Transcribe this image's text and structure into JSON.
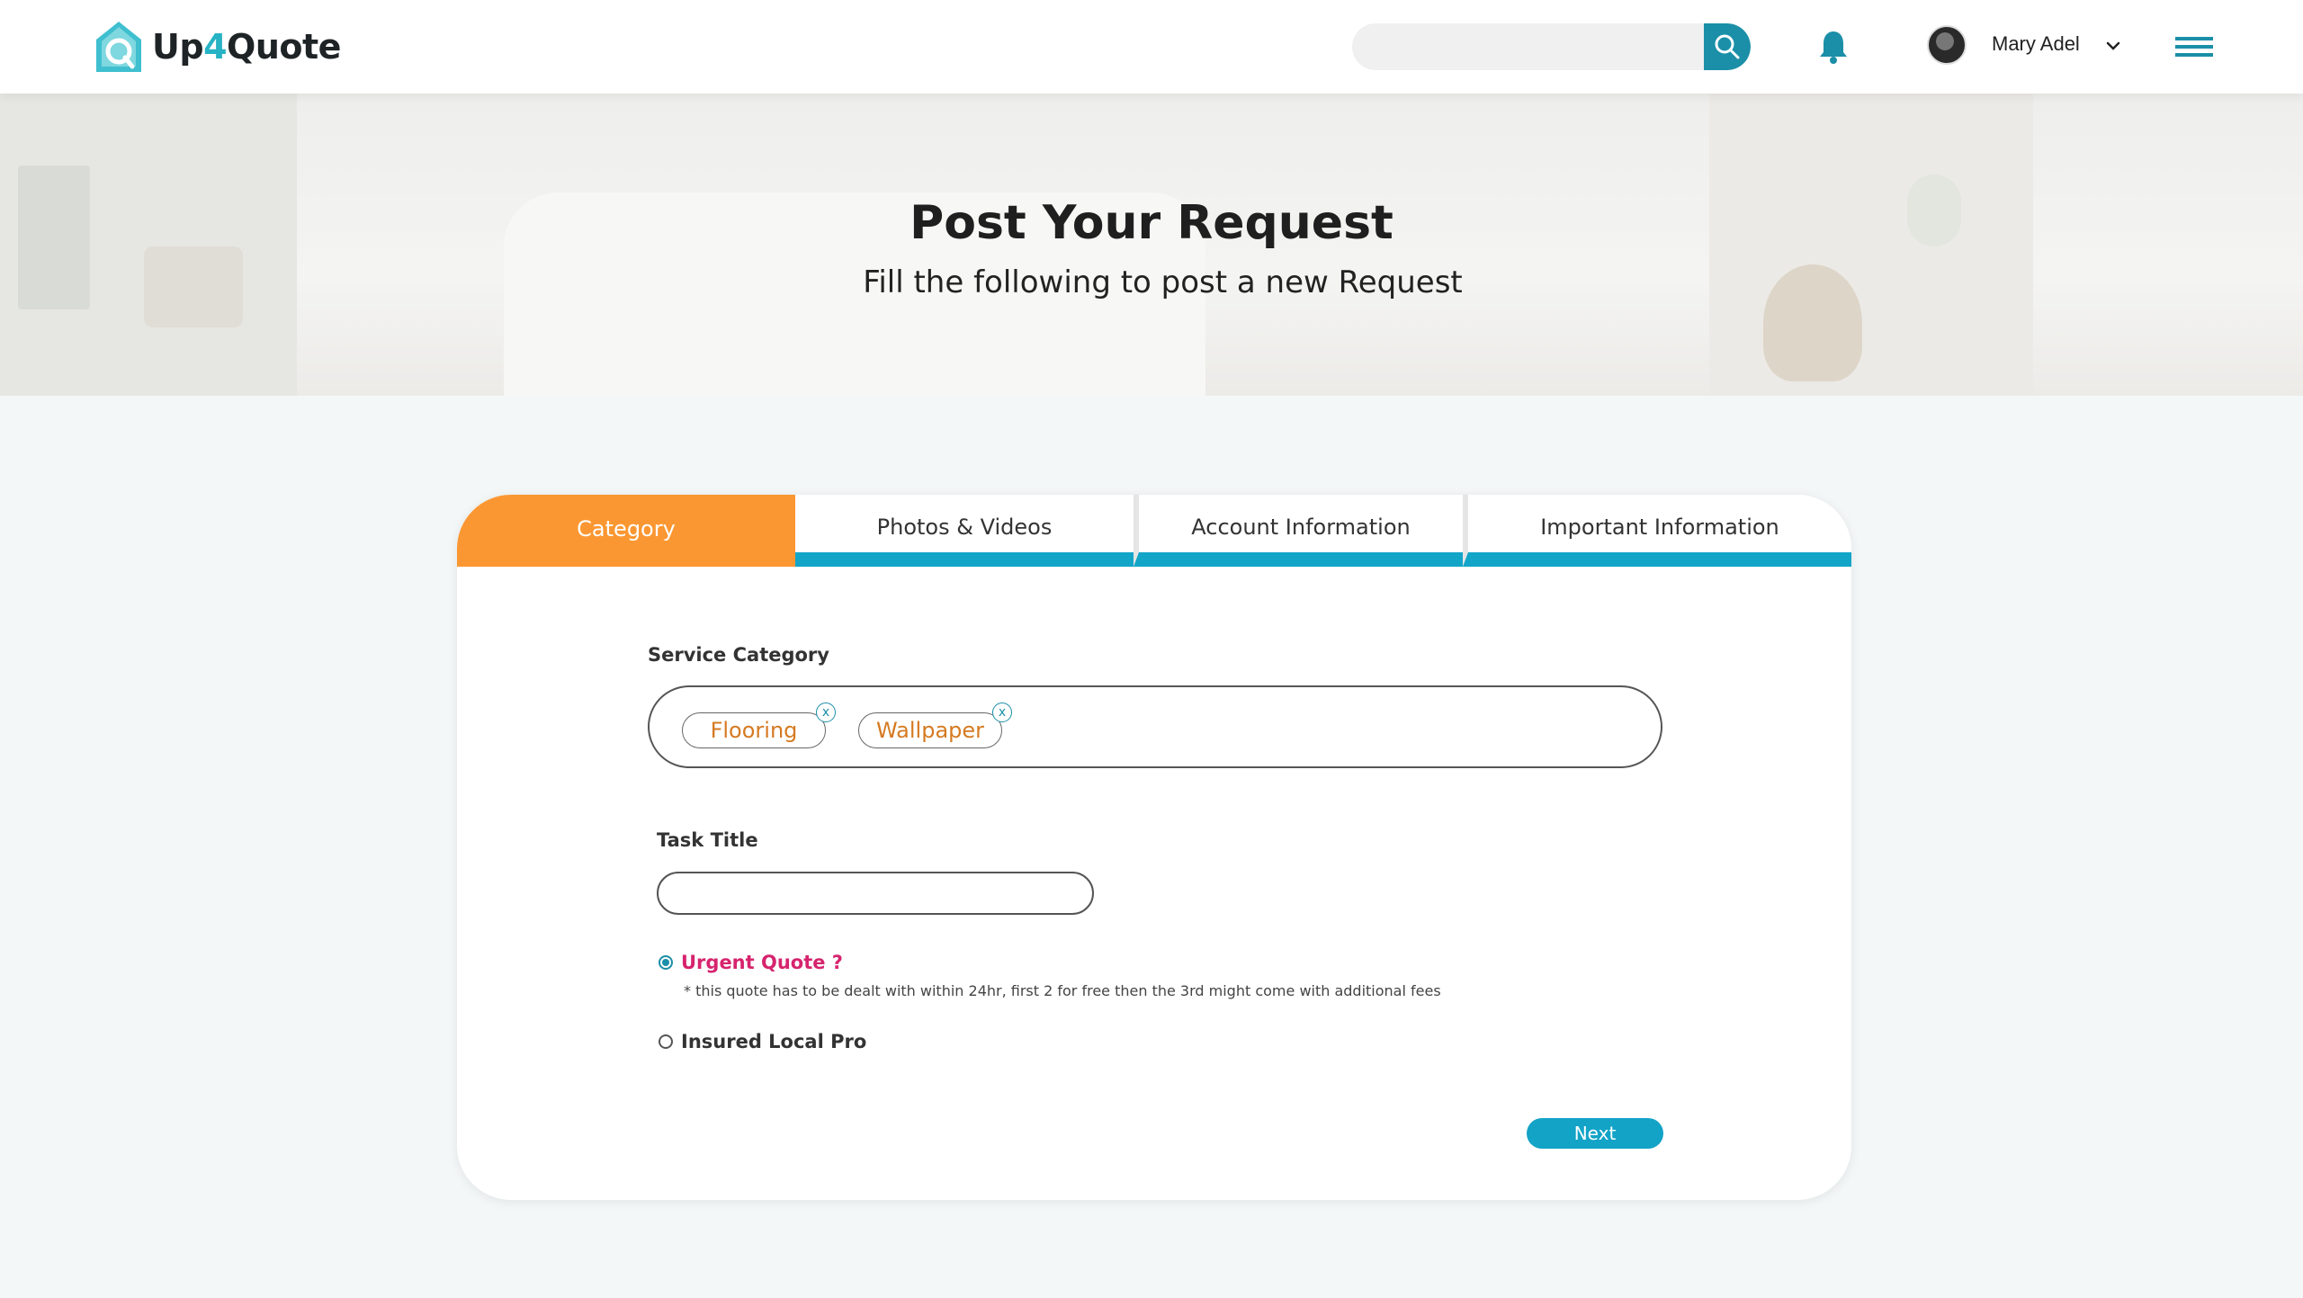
{
  "header": {
    "brand": {
      "prefix": "Up",
      "four": "4",
      "suffix": "Quote"
    },
    "search": {
      "placeholder": "",
      "value": ""
    },
    "user": {
      "name": "Mary Adel"
    }
  },
  "hero": {
    "title": "Post Your Request",
    "subtitle": "Fill the following to post a new Request"
  },
  "tabs": [
    {
      "label": "Category",
      "active": true
    },
    {
      "label": "Photos & Videos",
      "active": false
    },
    {
      "label": "Account Information",
      "active": false
    },
    {
      "label": "Important Information",
      "active": false
    }
  ],
  "form": {
    "service_category_label": "Service Category",
    "selected_categories": [
      {
        "label": "Flooring",
        "remove": "x"
      },
      {
        "label": "Wallpaper",
        "remove": "x"
      }
    ],
    "task_title_label": "Task Title",
    "task_title_value": "",
    "urgent": {
      "label": "Urgent Quote ?",
      "checked": true,
      "note": "* this quote has to be dealt with within 24hr, first 2 for free then the 3rd might come with additional fees"
    },
    "insured": {
      "label": "Insured Local Pro",
      "checked": false
    },
    "next_label": "Next"
  },
  "colors": {
    "accent_orange": "#fb9732",
    "accent_teal": "#13a5c8",
    "urgent_pink": "#d6246e",
    "chip_text": "#d57a22"
  }
}
